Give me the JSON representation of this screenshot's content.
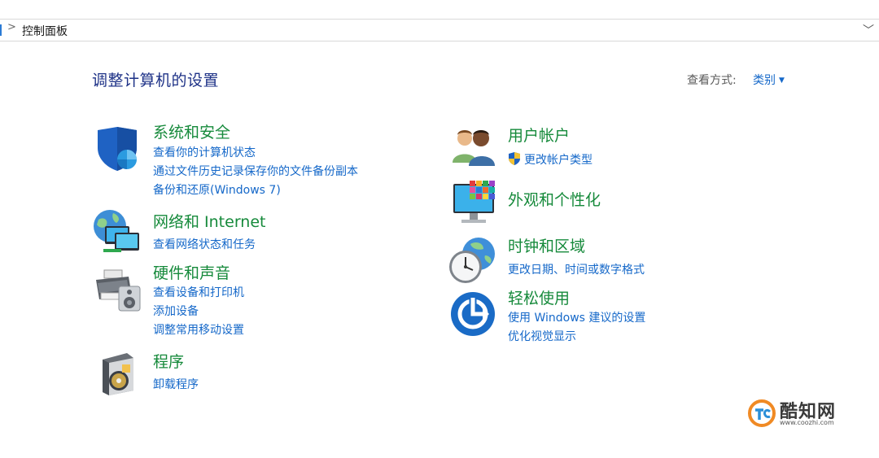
{
  "address_bar": {
    "crumb_separator": ">",
    "crumb": "控制面板",
    "dropdown_glyph": "﹀"
  },
  "header": {
    "title": "调整计算机的设置",
    "view_by_label": "查看方式:",
    "view_by_value": "类别"
  },
  "categories": [
    {
      "title": "系统和安全",
      "icon": "shield-icon",
      "links": [
        "查看你的计算机状态",
        "通过文件历史记录保存你的文件备份副本",
        "备份和还原(Windows 7)"
      ]
    },
    {
      "title": "网络和 Internet",
      "icon": "network-globe-icon",
      "links": [
        "查看网络状态和任务"
      ]
    },
    {
      "title": "硬件和声音",
      "icon": "printer-speaker-icon",
      "links": [
        "查看设备和打印机",
        "添加设备",
        "调整常用移动设置"
      ]
    },
    {
      "title": "程序",
      "icon": "programs-disc-icon",
      "links": [
        "卸载程序"
      ]
    },
    {
      "title": "用户帐户",
      "icon": "users-icon",
      "links": [
        "更改帐户类型"
      ]
    },
    {
      "title": "外观和个性化",
      "icon": "monitor-palette-icon",
      "links": []
    },
    {
      "title": "时钟和区域",
      "icon": "clock-globe-icon",
      "links": [
        "更改日期、时间或数字格式"
      ]
    },
    {
      "title": "轻松使用",
      "icon": "ease-of-access-icon",
      "links": [
        "使用 Windows 建议的设置",
        "优化视觉显示"
      ]
    }
  ],
  "watermark": {
    "name": "酷知网",
    "url": "www.coozhi.com",
    "logo": "coozhi-logo-icon"
  },
  "colors": {
    "title_blue": "#1e3287",
    "link_blue": "#1568c9",
    "category_green": "#168a3b"
  }
}
